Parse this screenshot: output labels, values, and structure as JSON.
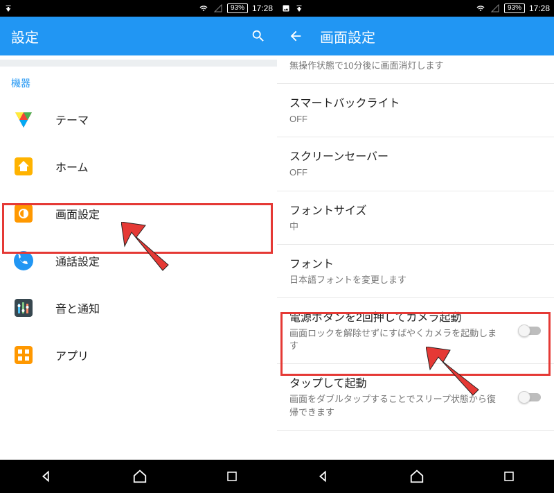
{
  "statusbar": {
    "battery": "93%",
    "time": "17:28"
  },
  "left": {
    "title": "設定",
    "section": "機器",
    "items": [
      {
        "label": "テーマ"
      },
      {
        "label": "ホーム"
      },
      {
        "label": "画面設定"
      },
      {
        "label": "通話設定"
      },
      {
        "label": "音と通知"
      },
      {
        "label": "アプリ"
      }
    ]
  },
  "right": {
    "title": "画面設定",
    "items": [
      {
        "title": "",
        "sub": "無操作状態で10分後に画面消灯します"
      },
      {
        "title": "スマートバックライト",
        "sub": "OFF"
      },
      {
        "title": "スクリーンセーバー",
        "sub": "OFF"
      },
      {
        "title": "フォントサイズ",
        "sub": "中"
      },
      {
        "title": "フォント",
        "sub": "日本語フォントを変更します"
      },
      {
        "title": "電源ボタンを2回押してカメラ起動",
        "sub": "画面ロックを解除せずにすばやくカメラを起動します"
      },
      {
        "title": "タップして起動",
        "sub": "画面をダブルタップすることでスリープ状態から復帰できます"
      }
    ]
  }
}
